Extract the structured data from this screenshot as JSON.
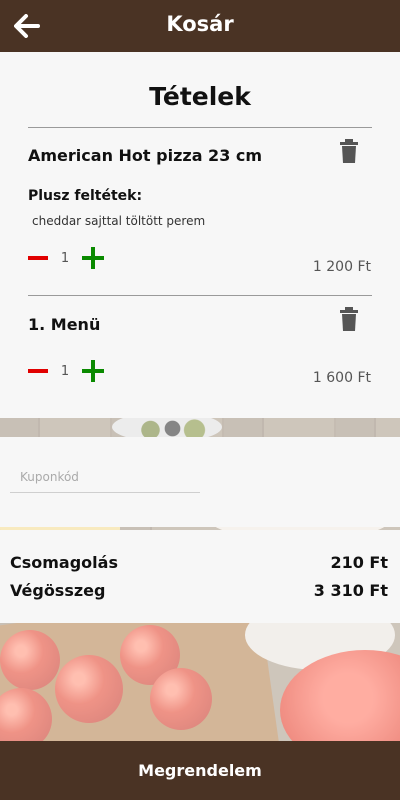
{
  "header": {
    "title": "Kosár",
    "back_icon": "arrow-left-icon"
  },
  "cart": {
    "section_title": "Tételek",
    "items": [
      {
        "name": "American Hot pizza 23 cm",
        "extras_label": "Plusz feltétek:",
        "extras": "cheddar sajttal töltött perem",
        "quantity": "1",
        "price": "1 200 Ft"
      },
      {
        "name": "1. Menü",
        "quantity": "1",
        "price": "1 600 Ft"
      }
    ]
  },
  "coupon": {
    "placeholder": "Kuponkód",
    "value": ""
  },
  "totals": {
    "packaging_label": "Csomagolás",
    "packaging_value": "210 Ft",
    "grand_total_label": "Végösszeg",
    "grand_total_value": "3 310 Ft"
  },
  "footer": {
    "order_button_label": "Megrendelem"
  },
  "colors": {
    "brand_brown": "#4a3324",
    "minus_red": "#e10000",
    "plus_green": "#0a8a00",
    "card_bg": "#f7f7f7"
  }
}
